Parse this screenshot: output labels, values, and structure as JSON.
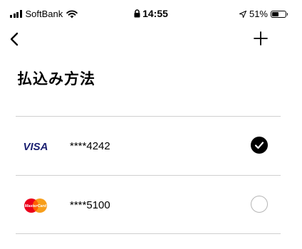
{
  "status_bar": {
    "carrier": "SoftBank",
    "time": "14:55",
    "battery": "51%",
    "battery_level": 0.51
  },
  "header": {
    "back_icon": "chevron-left-icon",
    "add_icon": "plus-icon",
    "title": "払込み方法"
  },
  "payment_methods": [
    {
      "brand": "VISA",
      "number": "****4242",
      "selected": true
    },
    {
      "brand": "MasterCard",
      "number": "****5100",
      "selected": false
    }
  ],
  "colors": {
    "visa_blue": "#1a1f71",
    "mastercard_red": "#eb001b",
    "mastercard_orange": "#f79e1b",
    "divider": "#cfcfcf"
  }
}
